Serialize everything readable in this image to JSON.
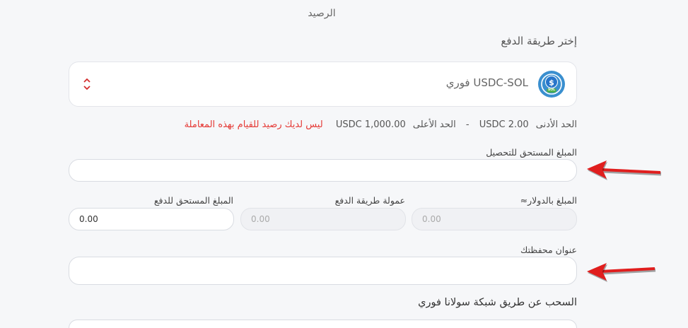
{
  "balance_label": "الرصيد",
  "payment_method": {
    "section_title": "إختر طريقة الدفع",
    "selected": "USDC-SOL فوري",
    "icon": "usdc-sol-coin-icon",
    "icon_badge": "SOL"
  },
  "limits": {
    "min_label": "الحد الأدنى",
    "min_value": "2.00 USDC",
    "separator": "-",
    "max_label": "الحد الأعلى",
    "max_value": "1,000.00 USDC",
    "error": "ليس لديك رصيد للقيام بهذه المعاملة"
  },
  "amount_due": {
    "label": "المبلغ المستحق للتحصيل",
    "value": ""
  },
  "usd_amount": {
    "label": "المبلغ بالدولار≈",
    "value": "0.00"
  },
  "fee": {
    "label": "عمولة طريقة الدفع",
    "value": "0.00"
  },
  "payable": {
    "label": "المبلغ المستحق للدفع",
    "value": "0.00"
  },
  "wallet": {
    "label": "عنوان محفظتك",
    "value": ""
  },
  "withdraw_note": "السحب عن طريق شبكة سولانا فوري",
  "colors": {
    "error": "#e53935",
    "arrow": "#e01e1e",
    "coin": "#3a8fcf"
  }
}
